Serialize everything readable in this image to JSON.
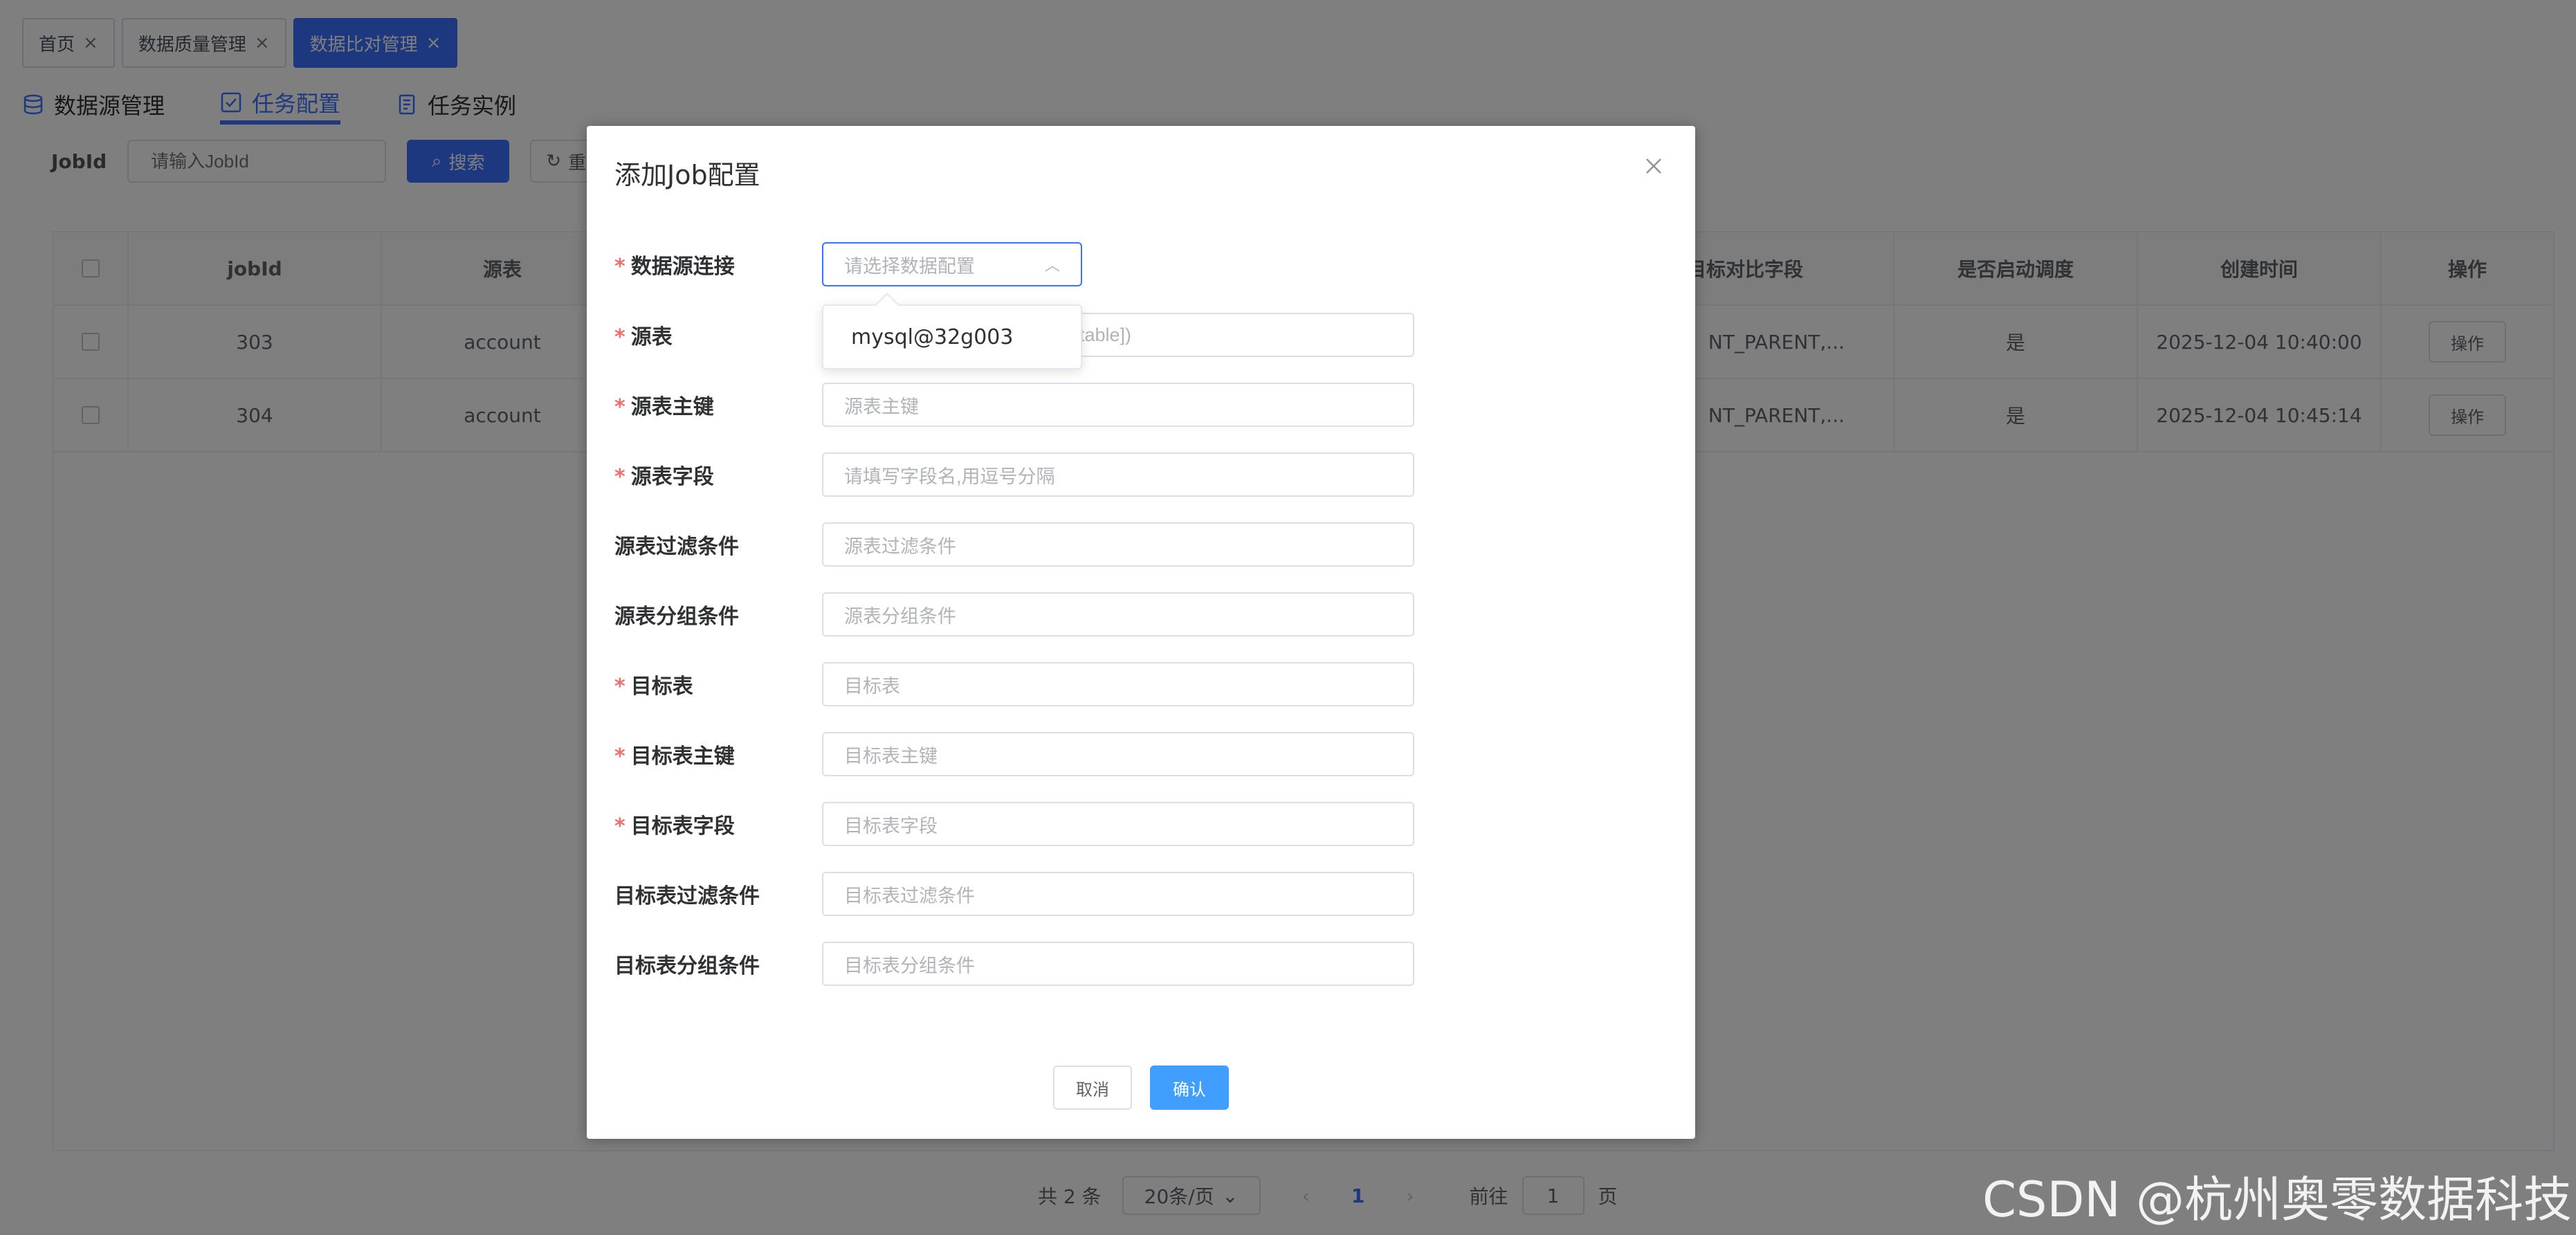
{
  "tags": [
    {
      "label": "首页"
    },
    {
      "label": "数据质量管理"
    },
    {
      "label": "数据比对管理"
    }
  ],
  "subtabs": [
    {
      "label": "数据源管理",
      "icon": "database-icon"
    },
    {
      "label": "任务配置",
      "icon": "checkbox-icon"
    },
    {
      "label": "任务实例",
      "icon": "document-icon"
    }
  ],
  "search": {
    "label": "JobId",
    "placeholder": "请输入JobId",
    "search_button": "搜索",
    "reset_button": "重置"
  },
  "table": {
    "headers": [
      "jobId",
      "源表",
      "目标对比字段",
      "是否启动调度",
      "创建时间",
      "操作"
    ],
    "rows": [
      {
        "jobId": "303",
        "source": "account",
        "target_fields": "NT_PARENT,...",
        "scheduled": "是",
        "created": "2025-12-04 10:40:00",
        "action": "操作"
      },
      {
        "jobId": "304",
        "source": "account",
        "target_fields": "NT_PARENT,...",
        "scheduled": "是",
        "created": "2025-12-04 10:45:14",
        "action": "操作"
      }
    ]
  },
  "pager": {
    "total": "共 2 条",
    "page_size": "20条/页",
    "current": "1",
    "goto_label": "前往",
    "goto_value": "1",
    "unit": "页"
  },
  "dialog": {
    "title": "添加Job配置",
    "fields": [
      {
        "label": "数据源连接",
        "required": true,
        "placeholder": "请选择数据配置"
      },
      {
        "label": "源表",
        "required": true,
        "placeholder": "table])"
      },
      {
        "label": "源表主键",
        "required": true,
        "placeholder": "源表主键"
      },
      {
        "label": "源表字段",
        "required": true,
        "placeholder": "请填写字段名,用逗号分隔"
      },
      {
        "label": "源表过滤条件",
        "required": false,
        "placeholder": "源表过滤条件"
      },
      {
        "label": "源表分组条件",
        "required": false,
        "placeholder": "源表分组条件"
      },
      {
        "label": "目标表",
        "required": true,
        "placeholder": "目标表"
      },
      {
        "label": "目标表主键",
        "required": true,
        "placeholder": "目标表主键"
      },
      {
        "label": "目标表字段",
        "required": true,
        "placeholder": "目标表字段"
      },
      {
        "label": "目标表过滤条件",
        "required": false,
        "placeholder": "目标表过滤条件"
      },
      {
        "label": "目标表分组条件",
        "required": false,
        "placeholder": "目标表分组条件"
      }
    ],
    "dropdown_option": "mysql@32g003",
    "cancel": "取消",
    "confirm": "确认"
  },
  "watermark": "CSDN @杭州奥零数据科技",
  "colors": {
    "primary": "#3a71ff",
    "confirm": "#409eff",
    "required": "#f56c6c"
  }
}
